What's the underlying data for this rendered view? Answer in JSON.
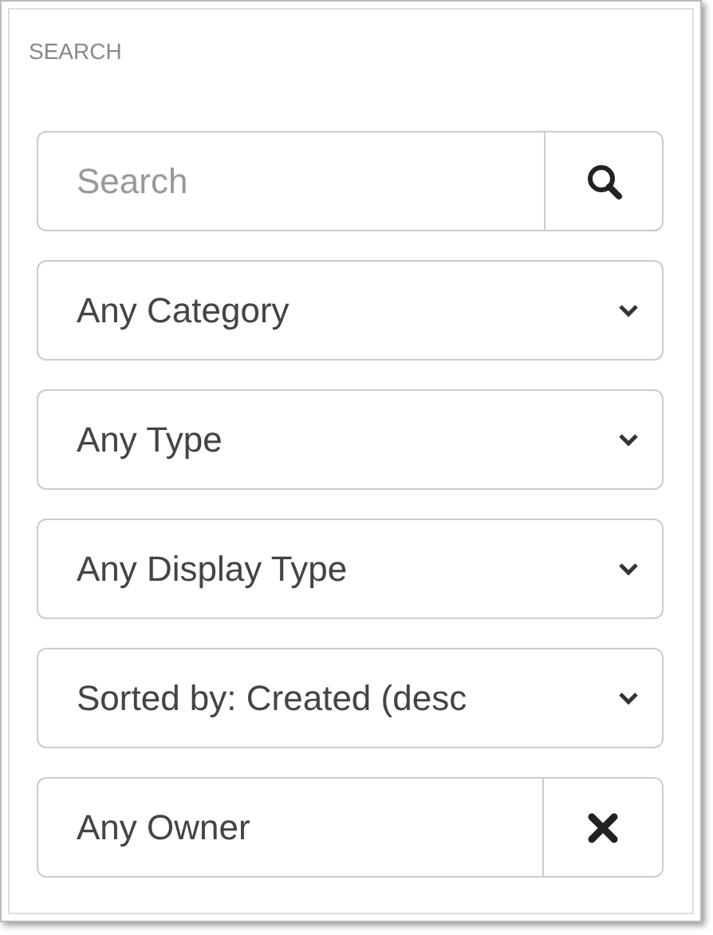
{
  "heading": "SEARCH",
  "search": {
    "placeholder": "Search"
  },
  "filters": [
    {
      "value": "Any Category"
    },
    {
      "value": "Any Type"
    },
    {
      "value": "Any Display Type"
    },
    {
      "value": "Sorted by: Created (desc"
    }
  ],
  "owner": {
    "value": "Any Owner"
  }
}
